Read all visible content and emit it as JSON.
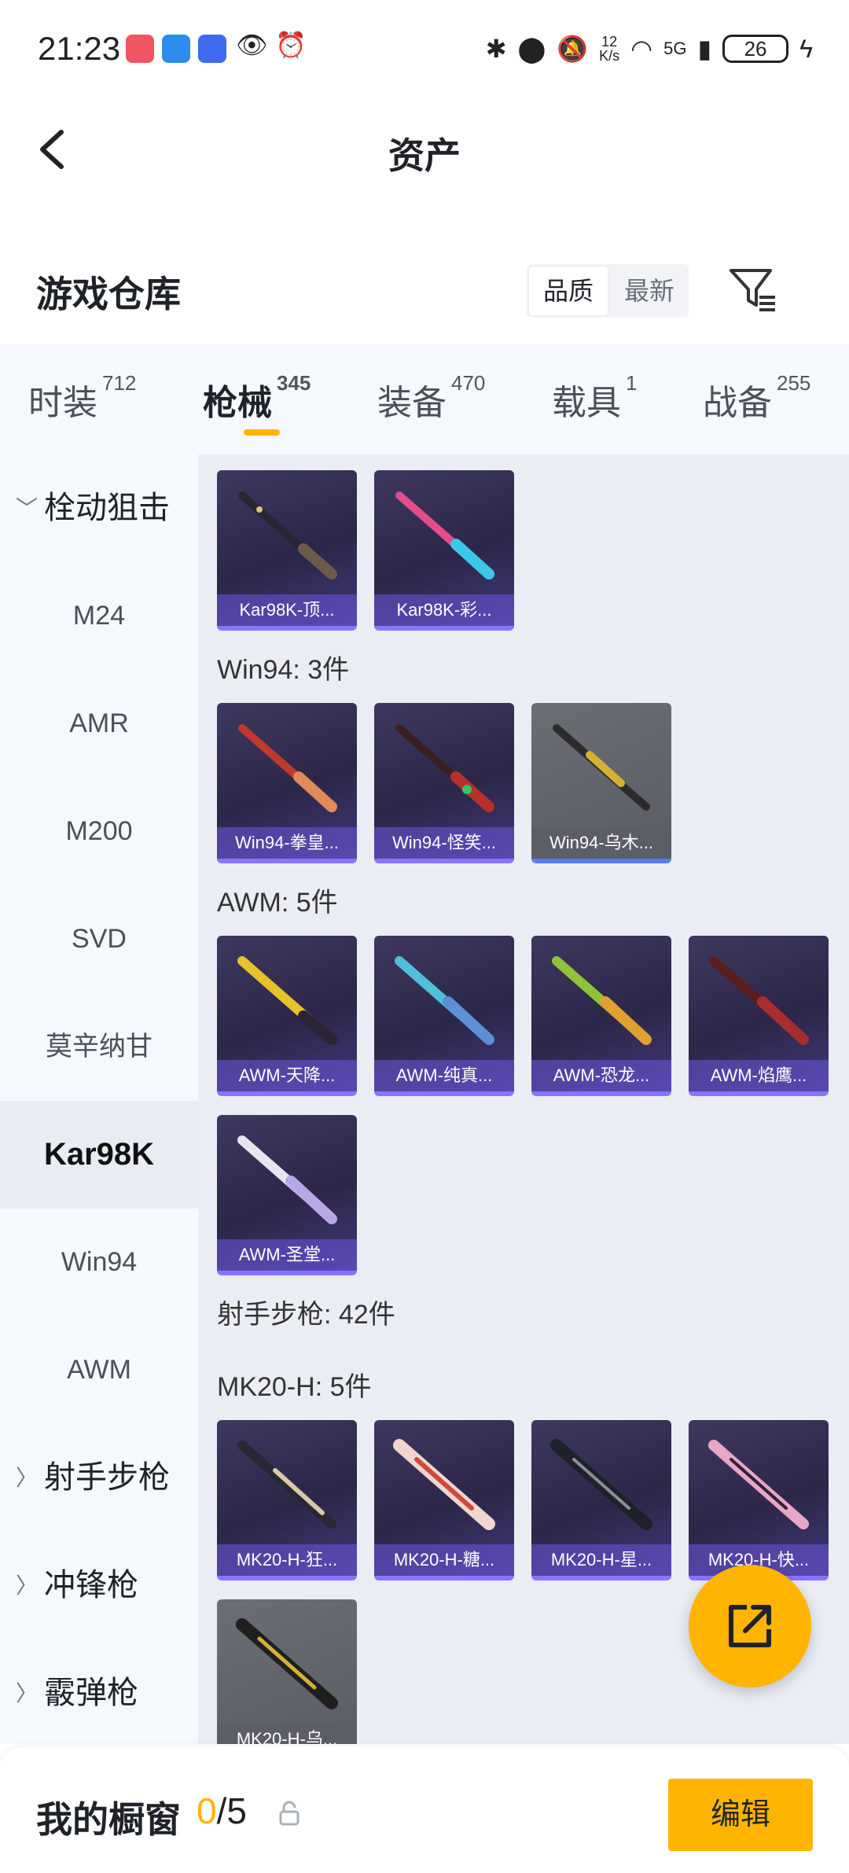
{
  "status_bar": {
    "time": "21:23",
    "net_speed_value": "12",
    "net_speed_unit": "K/s",
    "network": "5G",
    "battery": "26"
  },
  "header": {
    "title": "资产"
  },
  "warehouse": {
    "title": "游戏仓库",
    "sort_options": [
      "品质",
      "最新"
    ],
    "sort_selected": "品质"
  },
  "tabs": [
    {
      "label": "时装",
      "count": "712"
    },
    {
      "label": "枪械",
      "count": "345"
    },
    {
      "label": "装备",
      "count": "470"
    },
    {
      "label": "载具",
      "count": "1"
    },
    {
      "label": "战备",
      "count": "255"
    }
  ],
  "sidebar": {
    "items": [
      {
        "label": "栓动狙击"
      },
      {
        "label": "M24"
      },
      {
        "label": "AMR"
      },
      {
        "label": "M200"
      },
      {
        "label": "SVD"
      },
      {
        "label": "莫辛纳甘"
      },
      {
        "label": "Kar98K"
      },
      {
        "label": "Win94"
      },
      {
        "label": "AWM"
      },
      {
        "label": "射手步枪"
      },
      {
        "label": "冲锋枪"
      },
      {
        "label": "霰弹枪"
      }
    ]
  },
  "content": {
    "kar98k_cards": [
      "Kar98K-顶...",
      "Kar98K-彩..."
    ],
    "win94_header": "Win94: 3件",
    "win94_cards": [
      "Win94-拳皇...",
      "Win94-怪笑...",
      "Win94-乌木..."
    ],
    "awm_header": "AWM: 5件",
    "awm_cards": [
      "AWM-天降...",
      "AWM-纯真...",
      "AWM-恐龙...",
      "AWM-焰鹰...",
      "AWM-圣堂..."
    ],
    "dmr_header": "射手步枪: 42件",
    "mk20_header": "MK20-H: 5件",
    "mk20_cards": [
      "MK20-H-狂...",
      "MK20-H-糖...",
      "MK20-H-星...",
      "MK20-H-快...",
      "MK20-H-乌..."
    ]
  },
  "bottom_bar": {
    "title": "我的橱窗",
    "current": "0",
    "total": "/5",
    "edit_label": "编辑"
  },
  "colors": {
    "accent": "#ffb400",
    "card_border": "#8a74ff"
  }
}
